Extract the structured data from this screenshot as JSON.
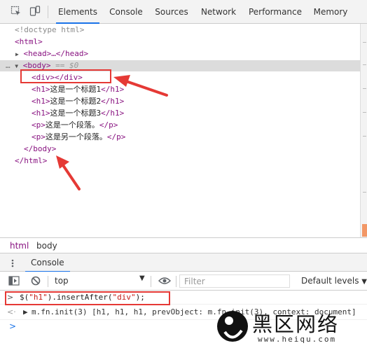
{
  "toolbar": {
    "tabs": [
      "Elements",
      "Console",
      "Sources",
      "Network",
      "Performance",
      "Memory"
    ],
    "active_tab": "Elements",
    "icons": [
      "inspect-element-icon",
      "device-toggle-icon"
    ]
  },
  "elements": {
    "doctype": "<!doctype html>",
    "html_open": "<html>",
    "head": "<head>…</head>",
    "body_open": "<body>",
    "eq": "== $0",
    "lines": [
      {
        "tag_open": "<div>",
        "text": "",
        "tag_close": "</div>"
      },
      {
        "tag_open": "<h1>",
        "text": "这是一个标题1",
        "tag_close": "</h1>"
      },
      {
        "tag_open": "<h1>",
        "text": "这是一个标题2",
        "tag_close": "</h1>"
      },
      {
        "tag_open": "<h1>",
        "text": "这是一个标题3",
        "tag_close": "</h1>"
      },
      {
        "tag_open": "<p>",
        "text": "这是一个段落。",
        "tag_close": "</p>"
      },
      {
        "tag_open": "<p>",
        "text": "这是另一个段落。",
        "tag_close": "</p>"
      }
    ],
    "body_close": "</body>",
    "html_close": "</html>"
  },
  "breadcrumb": [
    "html",
    "body"
  ],
  "drawer": {
    "tab": "Console"
  },
  "console_toolbar": {
    "context": "top",
    "filter_placeholder": "Filter",
    "levels": "Default levels"
  },
  "console": {
    "command_prefix": "$(",
    "command_arg1": "\"h1\"",
    "command_mid": ").insertAfter(",
    "command_arg2": "\"div\"",
    "command_suffix": ");",
    "result_text": "m.fn.init(3) [h1, h1, h1, prevObject: m.fn.init(3), context: document]"
  },
  "watermark": {
    "text": "黑区网络",
    "url": "www.heiqu.com"
  },
  "colors": {
    "accent": "#1a73e8",
    "tag": "#881280",
    "annotation_red": "#e53935"
  }
}
